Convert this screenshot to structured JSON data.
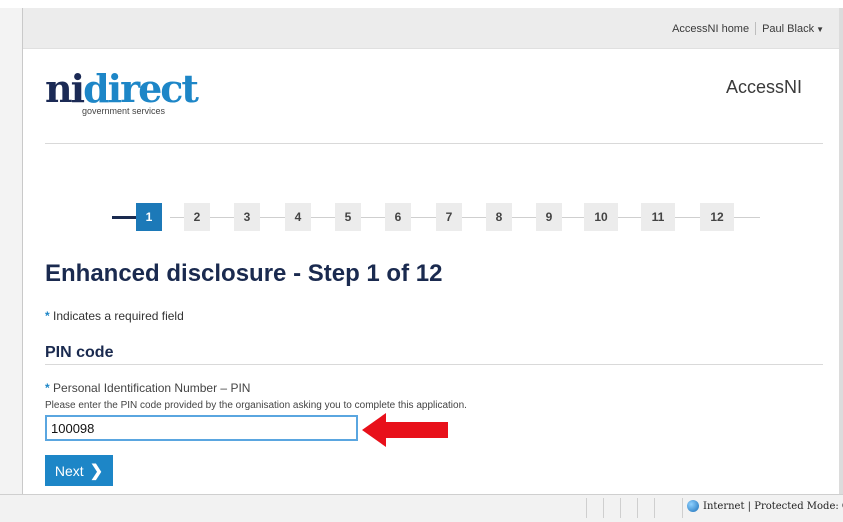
{
  "topbar": {
    "home_link": "AccessNI home",
    "user_menu": "Paul Black"
  },
  "header": {
    "logo_ni": "ni",
    "logo_direct": "direct",
    "logo_subtitle": "government services",
    "site_name": "AccessNI"
  },
  "progress": {
    "current_step": 1,
    "steps": [
      "1",
      "2",
      "3",
      "4",
      "5",
      "6",
      "7",
      "8",
      "9",
      "10",
      "11",
      "12"
    ]
  },
  "main": {
    "title": "Enhanced disclosure - Step 1 of 12",
    "required_note": "Indicates a required field",
    "section_title": "PIN code",
    "pin_label": "Personal Identification Number – PIN",
    "pin_help": "Please enter the PIN code provided by the organisation asking you to complete this application.",
    "pin_value": "100098",
    "next_label": "Next"
  },
  "statusbar": {
    "zone": "Internet | Protected Mode: On"
  },
  "colors": {
    "brand_navy": "#1a2a4f",
    "accent_blue": "#1d86c7",
    "annotation_arrow": "#e8101a"
  }
}
